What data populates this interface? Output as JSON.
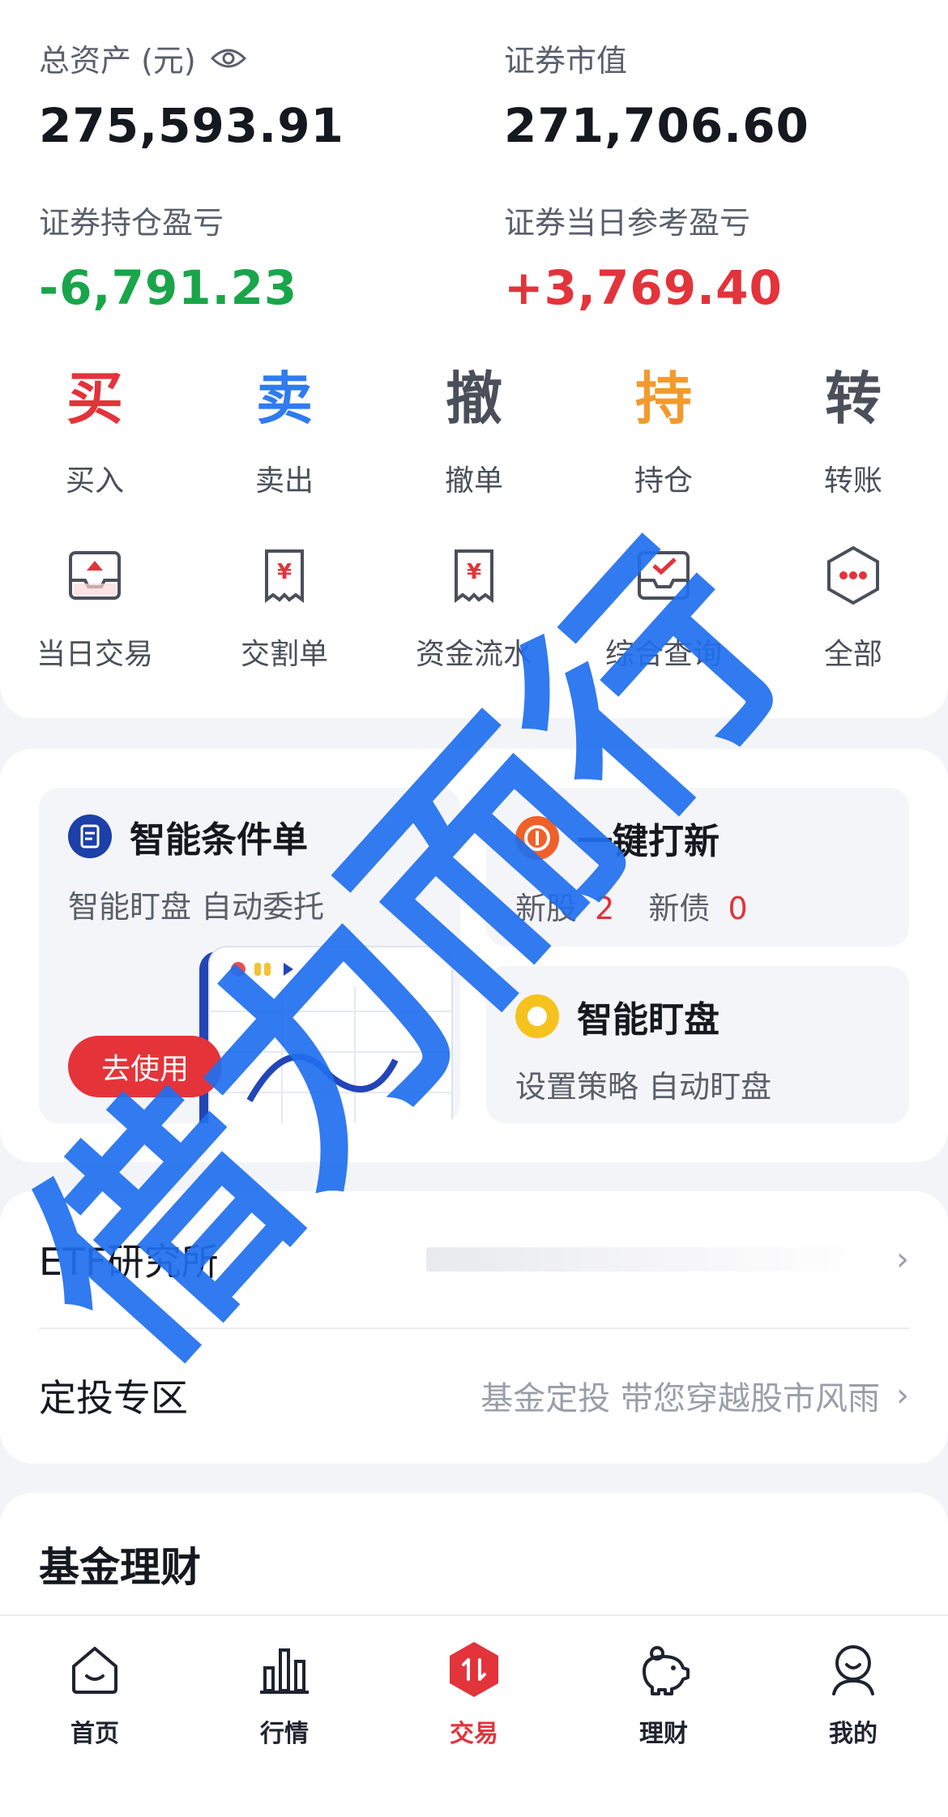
{
  "assets": {
    "total_label": "总资产 (元)",
    "total_value": "275,593.91",
    "market_label": "证券市值",
    "market_value": "271,706.60",
    "pnl_label": "证券持仓盈亏",
    "pnl_value": "-6,791.23",
    "daily_label": "证券当日参考盈亏",
    "daily_value": "+3,769.40"
  },
  "quick_actions": [
    {
      "char": "买",
      "label": "买入",
      "color": "#e3333b"
    },
    {
      "char": "卖",
      "label": "卖出",
      "color": "#2f7bf0"
    },
    {
      "char": "撤",
      "label": "撤单",
      "color": "#4a4f5a"
    },
    {
      "char": "持",
      "label": "持仓",
      "color": "#f29a2e"
    },
    {
      "char": "转",
      "label": "转账",
      "color": "#4a4f5a"
    }
  ],
  "tools": [
    {
      "label": "当日交易",
      "icon": "inbox-icon"
    },
    {
      "label": "交割单",
      "icon": "receipt-icon"
    },
    {
      "label": "资金流水",
      "icon": "receipt-icon"
    },
    {
      "label": "综合查询",
      "icon": "check-inbox-icon"
    },
    {
      "label": "全部",
      "icon": "more-hexagon-icon"
    }
  ],
  "features": {
    "condition_title": "智能条件单",
    "condition_sub": "智能盯盘 自动委托",
    "use_button": "去使用",
    "ipo_title": "一键打新",
    "ipo_stock_label": "新股",
    "ipo_stock_count": "2",
    "ipo_bond_label": "新债",
    "ipo_bond_count": "0",
    "monitor_title": "智能盯盘",
    "monitor_sub": "设置策略 自动盯盘"
  },
  "links": {
    "etf_title": "ETF研究所",
    "plan_title": "定投专区",
    "plan_desc": "基金定投 带您穿越股市风雨"
  },
  "fund": {
    "title": "基金理财"
  },
  "tabs": [
    {
      "label": "首页",
      "icon": "home-icon"
    },
    {
      "label": "行情",
      "icon": "bar-chart-icon"
    },
    {
      "label": "交易",
      "icon": "trade-icon"
    },
    {
      "label": "理财",
      "icon": "piggy-bank-icon"
    },
    {
      "label": "我的",
      "icon": "profile-icon"
    }
  ],
  "watermark": {
    "text": "借力而行"
  },
  "colors": {
    "accent": "#e3333b",
    "loss": "#19a54a",
    "blue": "#2f7bf0"
  }
}
